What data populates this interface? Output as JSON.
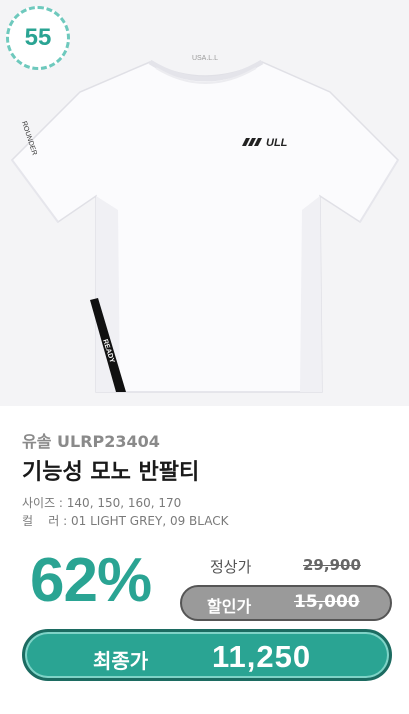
{
  "badge": {
    "number": "55"
  },
  "product": {
    "image_text": {
      "neck_label": "USA.L.L",
      "chest_logo": "/// ULL",
      "sleeve_text": "ROUNDER",
      "tape_text": "READY"
    },
    "brand": "유솔 ULRP23404",
    "title": "기능성 모노 반팔티",
    "sizes": "사이즈 : 140, 150, 160, 170",
    "colors": "컬    러 : 01 LIGHT GREY, 09 BLACK"
  },
  "pricing": {
    "discount_percent": "62%",
    "regular_label": "정상가",
    "regular_price": "29,900",
    "sale_label": "할인가",
    "sale_price": "15,000",
    "final_label": "최종가",
    "final_price": "11,250"
  },
  "colors": {
    "accent": "#2aa493",
    "accent_dark": "#1c6b61",
    "pill_grey": "#9a9a9a"
  }
}
